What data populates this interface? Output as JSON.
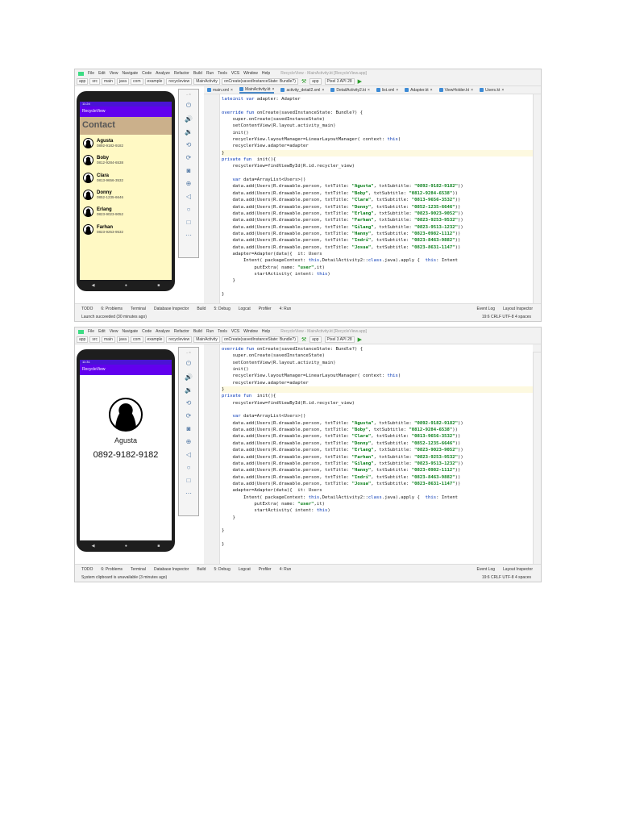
{
  "ide": {
    "menu": [
      "File",
      "Edit",
      "View",
      "Navigate",
      "Code",
      "Analyze",
      "Refactor",
      "Build",
      "Run",
      "Tools",
      "VCS",
      "Window",
      "Help"
    ],
    "title": "RecycleView - MainActivity.kt [RecycleView.app]",
    "breadcrumb": [
      "app",
      "src",
      "main",
      "java",
      "com",
      "example",
      "recycleview",
      "MainActivity",
      "onCreate(savedInstanceState: Bundle?)"
    ],
    "run_config": "app",
    "device": "Pixel 3 API 28",
    "tabs": [
      "main.xml",
      "MainActivity.kt",
      "activity_detail2.xml",
      "DetailActivity2.kt",
      "list.xml",
      "Adapter.kt",
      "ViewHolder.kt",
      "Users.kt"
    ],
    "tabs2": [
      "2.kt",
      "list.xml",
      "Adapter.kt",
      "ViewHolder.kt",
      "Users.kt"
    ],
    "bottom_tools": [
      "TODO",
      "6: Problems",
      "Terminal",
      "Database Inspector",
      "Build",
      "5: Debug",
      "Logcat",
      "Profiler",
      "4: Run"
    ],
    "bottom_right": [
      "Event Log",
      "Layout Inspector"
    ],
    "status_right": "19:6  CRLF  UTF-8  4 spaces"
  },
  "shot1": {
    "status": "Launch succeeded (30 minutes ago)",
    "code": [
      "lateinit var adapter: Adapter",
      "",
      "override fun onCreate(savedInstanceState: Bundle?) {",
      "    super.onCreate(savedInstanceState)",
      "    setContentView(R.layout.activity_main)",
      "    init()",
      "    recyclerView.layoutManager=LinearLayoutManager( context: this)",
      "    recyclerView.adapter=adapter",
      "}",
      "private fun  init(){",
      "    recyclerView=findViewById(R.id.recycler_view)",
      "",
      "    var data=ArrayList<Users>()",
      "    data.add(Users(R.drawable.person, txtTitle: \"Agusta\", txtSubtitle: \"0892-9182-9182\"))",
      "    data.add(Users(R.drawable.person, txtTitle: \"Boby\", txtSubtitle: \"0812-9284-6538\"))",
      "    data.add(Users(R.drawable.person, txtTitle: \"Clara\", txtSubtitle: \"0813-9656-3532\"))",
      "    data.add(Users(R.drawable.person, txtTitle: \"Donny\", txtSubtitle: \"0852-1235-6646\"))",
      "    data.add(Users(R.drawable.person, txtTitle: \"Erlang\", txtSubtitle: \"0823-9023-9052\"))",
      "    data.add(Users(R.drawable.person, txtTitle: \"Farhan\", txtSubtitle: \"0823-9253-9532\"))",
      "    data.add(Users(R.drawable.person, txtTitle: \"Gilang\", txtSubtitle: \"0823-9513-1232\"))",
      "    data.add(Users(R.drawable.person, txtTitle: \"Hanny\", txtSubtitle: \"0823-0982-1112\"))",
      "    data.add(Users(R.drawable.person, txtTitle: \"Indri\", txtSubtitle: \"0823-8463-9882\"))",
      "    data.add(Users(R.drawable.person, txtTitle: \"Josua\", txtSubtitle: \"0823-8631-1147\"))",
      "    adapter=Adapter(data){  it: Users",
      "        Intent( packageContext: this,DetailActivity2::class.java).apply {  this: Intent",
      "            putExtra( name: \"user\",it)",
      "            startActivity( intent: this)",
      "    }",
      "",
      "}"
    ],
    "phone": {
      "time": "11:24",
      "app_title": "RecycleView",
      "header": "Contact",
      "contacts": [
        {
          "name": "Agusta",
          "phone": "0892-9182-9182"
        },
        {
          "name": "Boby",
          "phone": "0812-9284-6538"
        },
        {
          "name": "Clara",
          "phone": "0813-9656-3532"
        },
        {
          "name": "Donny",
          "phone": "0852-1235-6646"
        },
        {
          "name": "Erlang",
          "phone": "0823-9023-9052"
        },
        {
          "name": "Farhan",
          "phone": "0823-9253-9532"
        }
      ]
    }
  },
  "shot2": {
    "status": "System clipboard is unavailable (3 minutes ago)",
    "code": [
      "override fun onCreate(savedInstanceState: Bundle?) {",
      "    super.onCreate(savedInstanceState)",
      "    setContentView(R.layout.activity_main)",
      "    init()",
      "    recyclerView.layoutManager=LinearLayoutManager( context: this)",
      "    recyclerView.adapter=adapter",
      "}",
      "private fun  init(){",
      "    recyclerView=findViewById(R.id.recycler_view)",
      "",
      "    var data=ArrayList<Users>()",
      "    data.add(Users(R.drawable.person, txtTitle: \"Agusta\", txtSubtitle: \"0892-9182-9182\"))",
      "    data.add(Users(R.drawable.person, txtTitle: \"Boby\", txtSubtitle: \"0812-9284-6538\"))",
      "    data.add(Users(R.drawable.person, txtTitle: \"Clara\", txtSubtitle: \"0813-9656-3532\"))",
      "    data.add(Users(R.drawable.person, txtTitle: \"Donny\", txtSubtitle: \"0852-1235-6646\"))",
      "    data.add(Users(R.drawable.person, txtTitle: \"Erlang\", txtSubtitle: \"0823-9023-9052\"))",
      "    data.add(Users(R.drawable.person, txtTitle: \"Farhan\", txtSubtitle: \"0823-9253-9532\"))",
      "    data.add(Users(R.drawable.person, txtTitle: \"Gilang\", txtSubtitle: \"0823-9513-1232\"))",
      "    data.add(Users(R.drawable.person, txtTitle: \"Hanny\", txtSubtitle: \"0823-0982-1112\"))",
      "    data.add(Users(R.drawable.person, txtTitle: \"Indri\", txtSubtitle: \"0823-8463-9882\"))",
      "    data.add(Users(R.drawable.person, txtTitle: \"Josua\", txtSubtitle: \"0823-8631-1147\"))",
      "    adapter=Adapter(data){  it: Users",
      "        Intent( packageContext: this,DetailActivity2::class.java).apply {  this: Intent",
      "            putExtra( name: \"user\",it)",
      "            startActivity( intent: this)",
      "    }",
      "",
      "}",
      "",
      "}"
    ],
    "phone": {
      "time": "11:31",
      "app_title": "RecycleView",
      "name": "Agusta",
      "phone": "0892-9182-9182"
    }
  }
}
